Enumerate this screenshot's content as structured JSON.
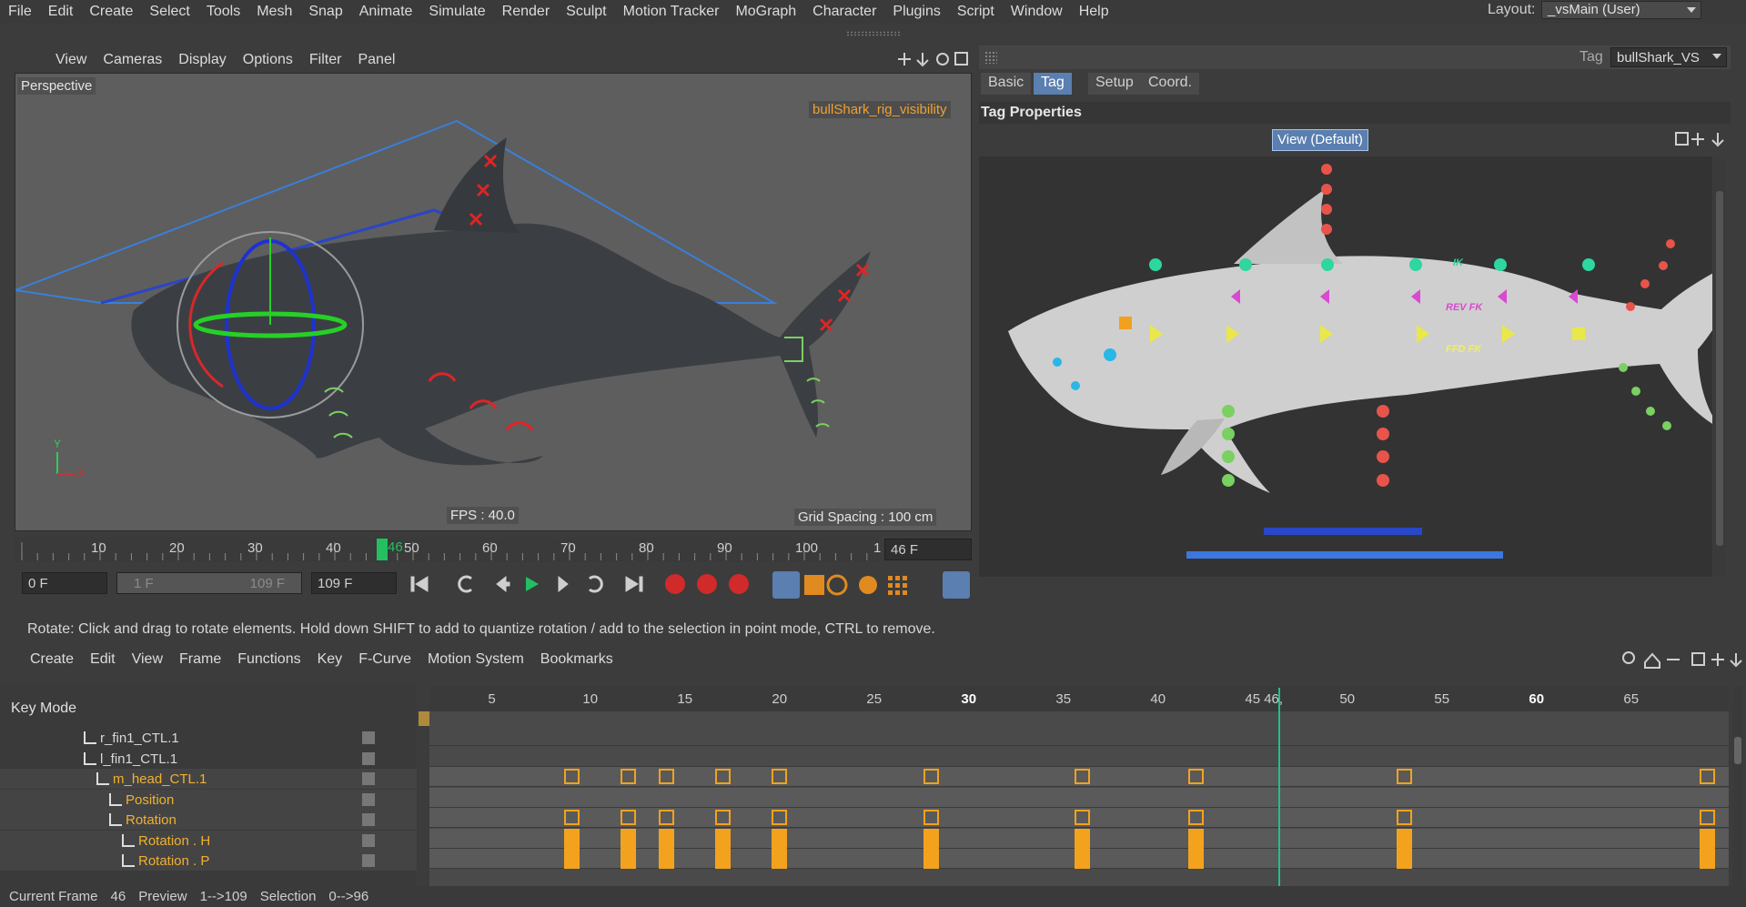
{
  "menu": [
    "File",
    "Edit",
    "Create",
    "Select",
    "Tools",
    "Mesh",
    "Snap",
    "Animate",
    "Simulate",
    "Render",
    "Sculpt",
    "Motion Tracker",
    "MoGraph",
    "Character",
    "Plugins",
    "Script",
    "Window",
    "Help"
  ],
  "layout": {
    "label": "Layout:",
    "value": "_vsMain (User)"
  },
  "viewport": {
    "menu": [
      "View",
      "Cameras",
      "Display",
      "Options",
      "Filter",
      "Panel"
    ],
    "name": "Perspective",
    "tag_label": "bullShark_rig_visibility",
    "fps": "FPS : 40.0",
    "grid": "Grid Spacing : 100 cm",
    "axis_y": "Y",
    "axis_x": "X"
  },
  "timeline": {
    "ticks": [
      "10",
      "20",
      "30",
      "40",
      "50",
      "60",
      "70",
      "80",
      "90",
      "100",
      "1"
    ],
    "current_marker": "46",
    "frame_box": "46 F",
    "start_field": "0 F",
    "range_left": "1 F",
    "range_right": "109 F",
    "end_field": "109 F"
  },
  "attributes": {
    "header_label": "Tag",
    "object_select": "bullShark_VS",
    "tabs": [
      "Basic",
      "Tag",
      "Setup",
      "Coord."
    ],
    "active_tab": "Tag",
    "section": "Tag Properties",
    "view_button": "View (Default)",
    "labels": {
      "ik": "IK",
      "rev_fk": "REV FK",
      "ffd_fk": "FFD FK"
    }
  },
  "status_text": "Rotate: Click and drag to rotate elements. Hold down SHIFT to add to quantize rotation / add to the selection in point mode, CTRL to remove.",
  "timeline_editor": {
    "menu": [
      "Create",
      "Edit",
      "View",
      "Frame",
      "Functions",
      "Key",
      "F-Curve",
      "Motion System",
      "Bookmarks"
    ],
    "mode": "Key Mode",
    "ruler": [
      "5",
      "10",
      "15",
      "20",
      "25",
      "30",
      "35",
      "40",
      "45",
      "46,",
      "50",
      "55",
      "60",
      "65"
    ],
    "tree": [
      {
        "name": "r_fin1_CTL.1",
        "indent": 0,
        "highlight": false
      },
      {
        "name": "l_fin1_CTL.1",
        "indent": 0,
        "highlight": false
      },
      {
        "name": "m_head_CTL.1",
        "indent": 1,
        "highlight": true
      },
      {
        "name": "Position",
        "indent": 2,
        "highlight": true
      },
      {
        "name": "Rotation",
        "indent": 2,
        "highlight": true
      },
      {
        "name": "Rotation . H",
        "indent": 3,
        "highlight": true
      },
      {
        "name": "Rotation . P",
        "indent": 3,
        "highlight": true
      }
    ]
  },
  "bottom": {
    "current_frame_label": "Current Frame",
    "current_frame": "46",
    "preview_label": "Preview",
    "preview": "1-->109",
    "selection_label": "Selection",
    "selection": "0-->96"
  },
  "colors": {
    "accent": "#5a7fb0",
    "key": "#f3a21e",
    "playhead": "#20c08a",
    "viewport_bg": "#5e5e5e"
  }
}
